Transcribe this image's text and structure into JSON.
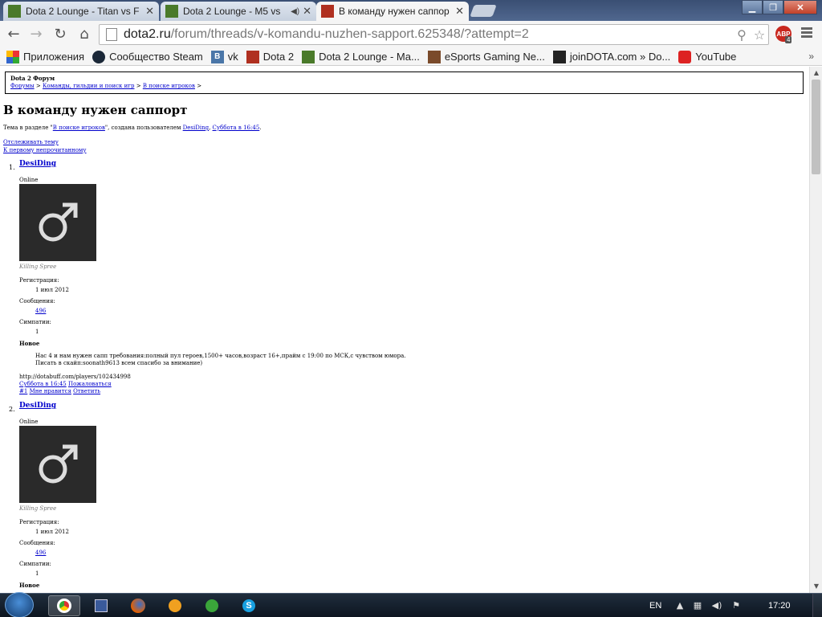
{
  "browser": {
    "tabs": [
      {
        "title": "Dota 2 Lounge - Titan vs F"
      },
      {
        "title": "Dota 2 Lounge - M5 vs "
      },
      {
        "title": "В команду нужен саппор"
      }
    ],
    "url_domain": "dota2.ru",
    "url_path": "/forum/threads/v-komandu-nuzhen-sapport.625348/?attempt=2",
    "abp_label": "ABP",
    "abp_count": "4",
    "bookmarks": [
      {
        "label": "Приложения",
        "icon": "apps-grid-icon"
      },
      {
        "label": "Сообщество Steam",
        "icon": "steam-icon"
      },
      {
        "label": "vk",
        "icon": "vk-icon"
      },
      {
        "label": "Dota 2",
        "icon": "dota2-icon"
      },
      {
        "label": "Dota 2 Lounge - Ma...",
        "icon": "dota2lounge-icon"
      },
      {
        "label": "eSports Gaming Ne...",
        "icon": "esports-icon"
      },
      {
        "label": "joinDOTA.com » Do...",
        "icon": "joindota-icon"
      },
      {
        "label": "YouTube",
        "icon": "youtube-icon"
      }
    ],
    "bookmarks_more": "»"
  },
  "page": {
    "forum_name": "Dota 2 Форум",
    "breadcrumbs": [
      "Форумы",
      "Команды, гильдии и поиск игр",
      "В поиске игроков"
    ],
    "crumb_sep": ">",
    "title": "В команду нужен саппорт",
    "meta_prefix": "Тема в разделе \"",
    "meta_section": "В поиске игроков",
    "meta_mid": "\", создана пользователем ",
    "meta_author": "DesiDing",
    "meta_sep": ", ",
    "meta_date": "Суббота в 16:45",
    "meta_end": ".",
    "watch_link": "Отслеживать тему",
    "first_unread_link": "К первому непрочитанному",
    "posts": [
      {
        "num": "1.",
        "author": "DesiDing",
        "status": "Online",
        "rank": "Killing Spree",
        "reg_label": "Регистрация:",
        "reg_value": "1 июл 2012",
        "msgs_label": "Сообщения:",
        "msgs_value": "496",
        "likes_label": "Симпатии:",
        "likes_value": "1",
        "new_label": "Новое",
        "text1": "Нас 4 и нам нужен сапп требования:полный пул героев,1500+ часов,возраст 16+,прайм с 19:00 по МСК,с чувством юмора.",
        "text2": "Писать в скайп:soonath9613 всем спасибо за внимание)",
        "signature": "http://dotabuff.com/players/102434998",
        "date": "Суббота в 16:45",
        "report": "Пожаловаться",
        "permalink": "#1",
        "like": "Мне нравится",
        "reply": "Ответить"
      },
      {
        "num": "2.",
        "author": "DesiDing",
        "status": "Online",
        "rank": "Killing Spree",
        "reg_label": "Регистрация:",
        "reg_value": "1 июл 2012",
        "msgs_label": "Сообщения:",
        "msgs_value": "496",
        "likes_label": "Симпатии:",
        "likes_value": "1",
        "new_label": "Новое"
      }
    ]
  },
  "taskbar": {
    "apps": [
      "chrome-icon",
      "save-disk-icon",
      "firefox-icon",
      "aimp-icon",
      "utorrent-icon",
      "skype-icon"
    ],
    "lang": "EN",
    "clock": "17:20"
  }
}
